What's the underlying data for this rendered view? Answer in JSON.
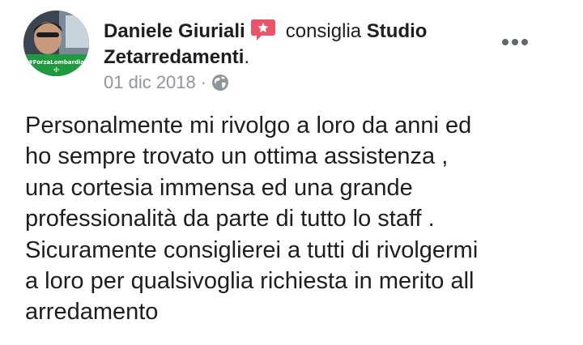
{
  "post": {
    "author": "Daniele Giuriali",
    "verb": "consiglia",
    "page_name": "Studio Zetarredamenti",
    "page_suffix": ".",
    "date": "01 dic 2018",
    "separator": "·",
    "privacy_icon": "globe-icon",
    "recommend_icon": "recommendation-badge-icon",
    "more_icon": "more-options-icon",
    "avatar_badge_text": "#ForzaLombardia",
    "avatar_badge_symbol": "✣",
    "body": "Personalmente mi rivolgo a loro da anni ed\nho sempre trovato un ottima assistenza ,\nuna cortesia immensa ed una grande\nprofessionalità da parte di tutto lo staff .\nSicuramente consiglierei a tutti di rivolgermi\na loro per qualsivoglia richiesta in merito all\narredamento"
  },
  "colors": {
    "text": "#1c1e21",
    "meta": "#90949c",
    "recommend": "#e9546b",
    "badge_green": "#1f9a3e"
  }
}
